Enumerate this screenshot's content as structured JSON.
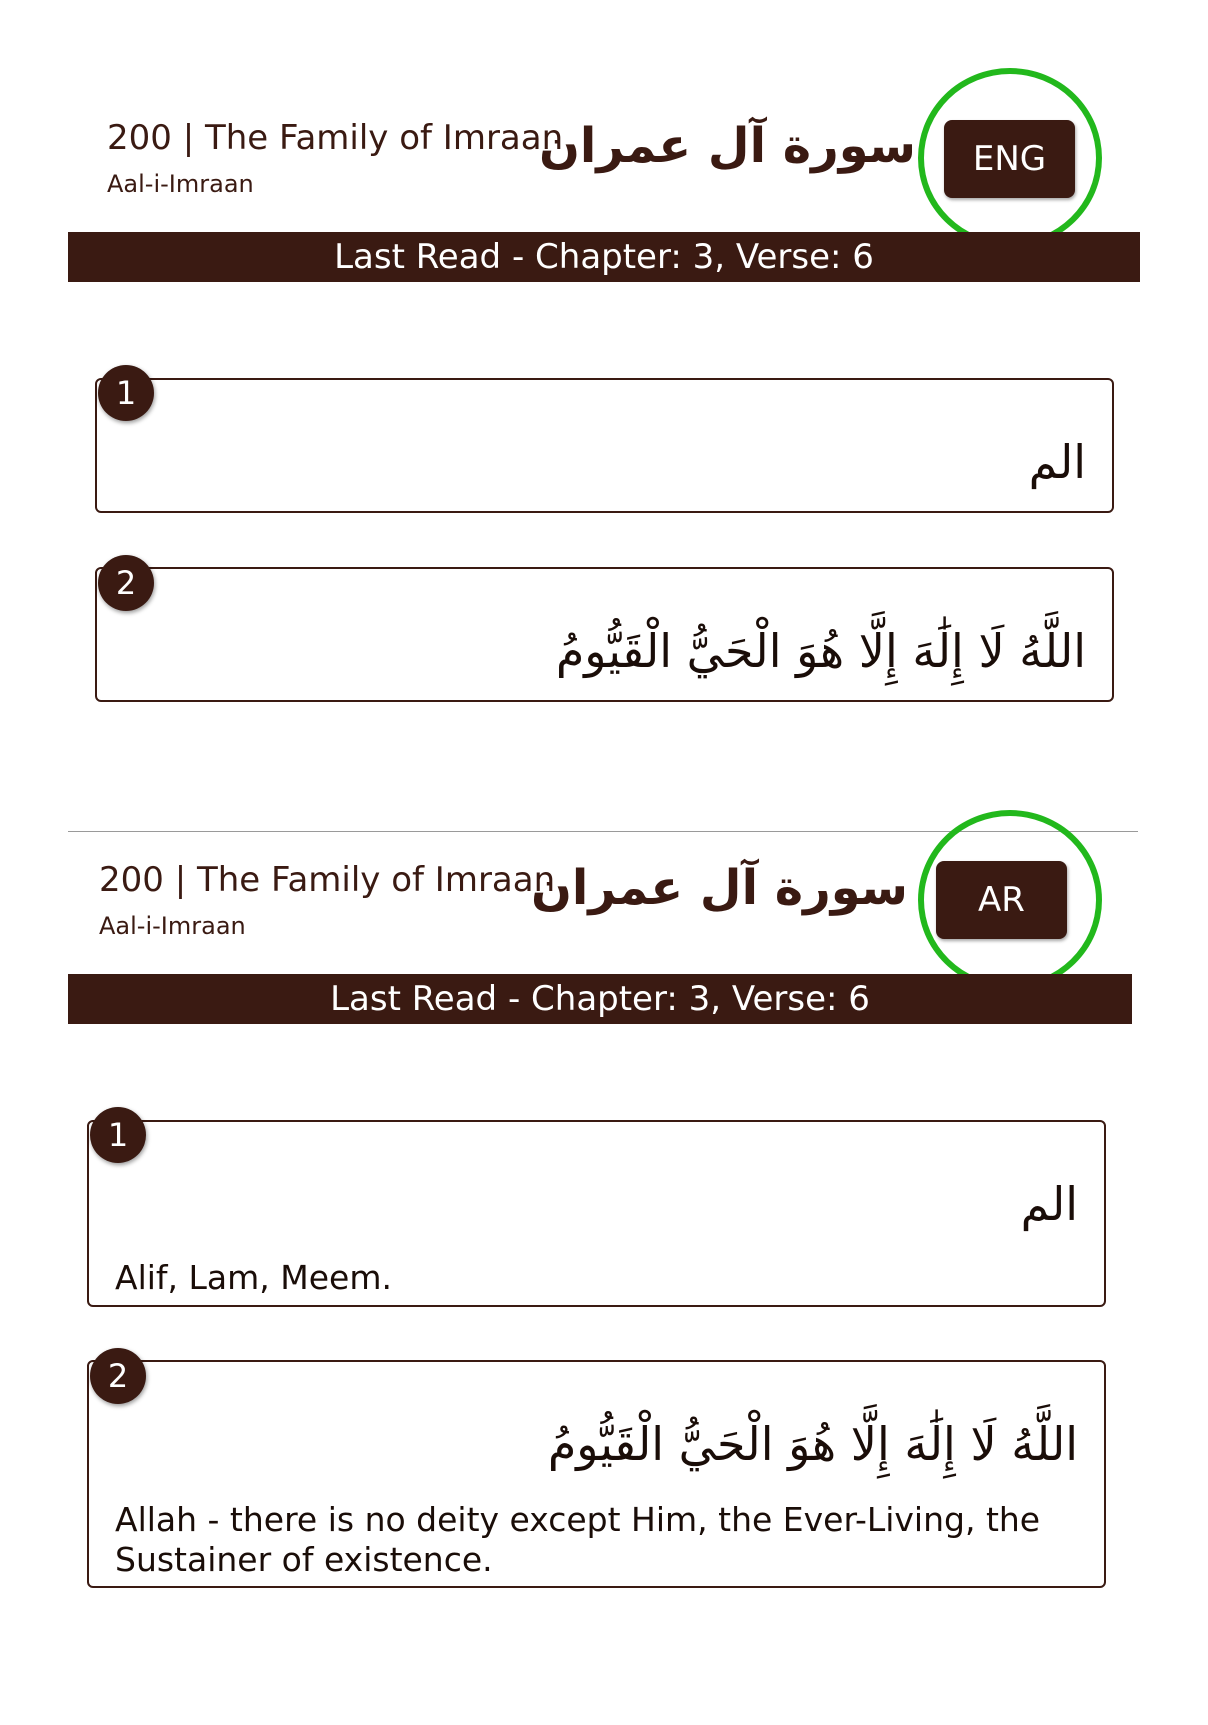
{
  "screens": [
    {
      "header": {
        "title": "200 | The Family of Imraan",
        "subtitle": "Aal-i-Imraan",
        "arabic_title": "سورة آل عمران",
        "lang_button": "ENG"
      },
      "last_read": "Last Read - Chapter: 3, Verse: 6",
      "verses": [
        {
          "number": "1",
          "arabic": "الم",
          "translation": ""
        },
        {
          "number": "2",
          "arabic": "اللَّهُ لَا إِلَٰهَ إِلَّا هُوَ الْحَيُّ الْقَيُّومُ",
          "translation": ""
        }
      ]
    },
    {
      "header": {
        "title": "200 | The Family of Imraan",
        "subtitle": "Aal-i-Imraan",
        "arabic_title": "سورة آل عمران",
        "lang_button": "AR"
      },
      "last_read": "Last Read - Chapter: 3, Verse: 6",
      "verses": [
        {
          "number": "1",
          "arabic": "الم",
          "translation": "Alif, Lam, Meem."
        },
        {
          "number": "2",
          "arabic": "اللَّهُ لَا إِلَٰهَ إِلَّا هُوَ الْحَيُّ الْقَيُّومُ",
          "translation": "Allah - there is no deity except Him, the Ever-Living, the Sustainer of existence."
        }
      ]
    }
  ],
  "colors": {
    "primary": "#3a1a12",
    "highlight": "#22b81c",
    "background": "#ffffff"
  }
}
